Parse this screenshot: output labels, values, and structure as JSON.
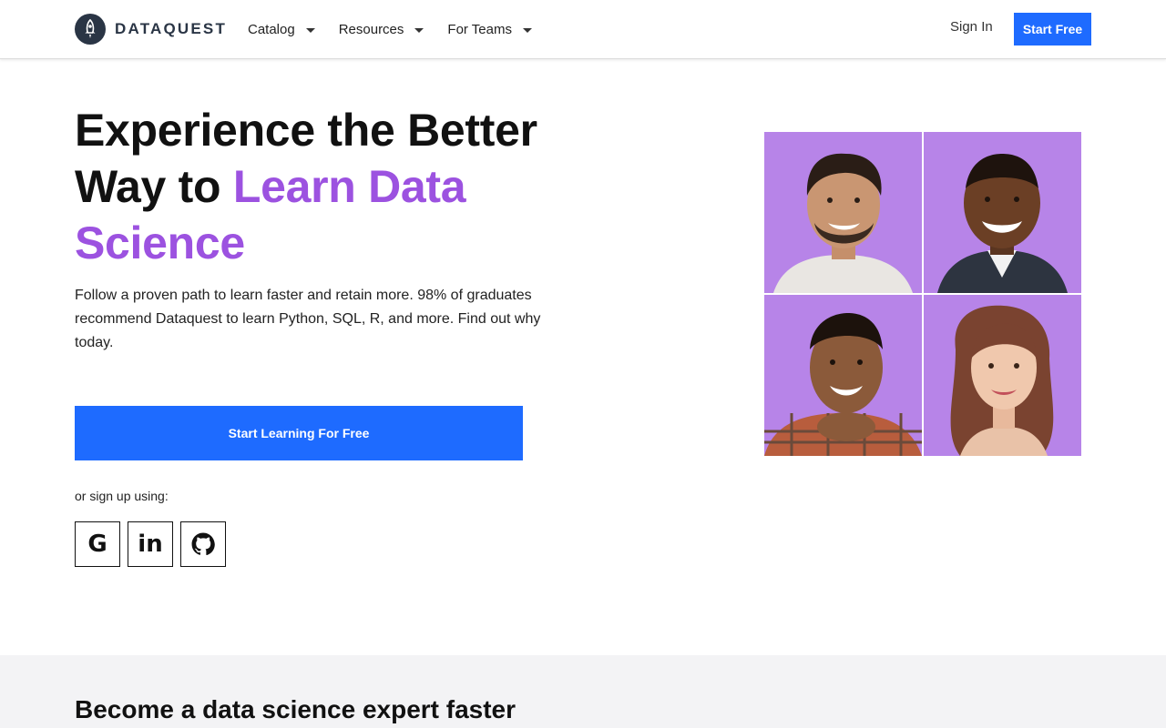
{
  "header": {
    "logo_text": "DATAQUEST",
    "nav": [
      {
        "label": "Catalog"
      },
      {
        "label": "Resources"
      },
      {
        "label": "For Teams"
      }
    ],
    "sign_in": "Sign In",
    "start_free": "Start Free"
  },
  "hero": {
    "title_line1": "Experience the Better",
    "title_line2_plain": "Way to ",
    "title_accent": "Learn Data Science",
    "subtitle": "Follow a proven path to learn faster and retain more. 98% of graduates recommend Dataquest to learn Python, SQL, R, and more. Find out why today.",
    "cta": "Start Learning For Free",
    "or_sign_up": "or sign up using:",
    "social": [
      {
        "icon": "google-icon",
        "glyph": "G"
      },
      {
        "icon": "linkedin-icon",
        "glyph": "in"
      },
      {
        "icon": "github-icon",
        "glyph": ""
      }
    ]
  },
  "section": {
    "title": "Become a data science expert faster"
  },
  "colors": {
    "accent_purple": "#9c52e0",
    "brand_blue": "#1e6bff",
    "photo_bg": "#b784e8"
  }
}
